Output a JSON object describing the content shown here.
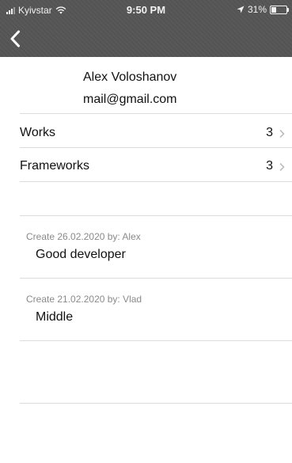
{
  "status_bar": {
    "carrier": "Kyivstar",
    "time": "9:50 PM",
    "battery": "31%",
    "battery_level": 0.31
  },
  "nav": {
    "back_icon": "chevron-left-icon"
  },
  "profile": {
    "name": "Alex Voloshanov",
    "email": "mail@gmail.com"
  },
  "rows": [
    {
      "label": "Works",
      "count": "3"
    },
    {
      "label": "Frameworks",
      "count": "3"
    }
  ],
  "reviews": [
    {
      "meta": "Create 26.02.2020 by: Alex",
      "text": "Good developer"
    },
    {
      "meta": "Create 21.02.2020 by: Vlad",
      "text": "Middle"
    }
  ]
}
